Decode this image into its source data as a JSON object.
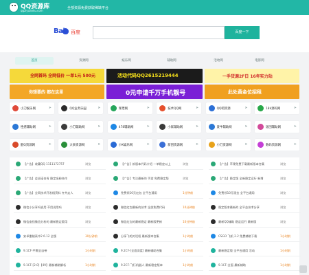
{
  "header": {
    "logo_title": "QQ资源库",
    "logo_sub": "qqziyuanku.com",
    "slogan": "全部资源免费获取稀缺平台"
  },
  "search": {
    "brand": "Bai",
    "brand_cn": "百度",
    "placeholder": "",
    "button": "百度一下"
  },
  "tabs": [
    "首页",
    "资源网",
    "娱乐网",
    "辅助网",
    "活动网",
    "电影网"
  ],
  "ads": [
    {
      "text": "全网首码 全网低价 一单1元 500元",
      "bg": "#f5d93a",
      "color": "#c01515"
    },
    {
      "text": "活动代码QQ2615219444",
      "bg": "#1b1b1b",
      "color": "#f8e21b"
    },
    {
      "text": "一手货源2F日 16年实力站",
      "bg": "#fff3a8",
      "color": "#d02a2a"
    },
    {
      "text": "你想要的 都在这里",
      "bg": "#f3a726",
      "color": "#ffffff"
    },
    {
      "text": "0元申请千万手机靓号",
      "bg": "#7a1fd6",
      "color": "#ffffff"
    },
    {
      "text": "此处黄金位招租",
      "bg": "#f0a020",
      "color": "#ffffff"
    }
  ],
  "cards": [
    {
      "label": "小刀娱乐网",
      "color": "#e04a3a"
    },
    {
      "label": "QQ业务乐园",
      "color": "#2a2a2a"
    },
    {
      "label": "辉煌网",
      "color": "#26a65b"
    },
    {
      "label": "技术QQ网",
      "color": "#e6502d"
    },
    {
      "label": "QQ吧资源",
      "color": "#2b6fd6"
    },
    {
      "label": "18k源码网",
      "color": "#28a84a"
    },
    {
      "label": "性感辅助网",
      "color": "#2b78d6"
    },
    {
      "label": "小刀辅助网",
      "color": "#3b3b3b"
    },
    {
      "label": "478辅助网",
      "color": "#1e88e5"
    },
    {
      "label": "小家辅助网",
      "color": "#3a3a3a"
    },
    {
      "label": "爱牛辅助网",
      "color": "#2b78d6"
    },
    {
      "label": "饭团辅助网",
      "color": "#d24a9a"
    },
    {
      "label": "酷Q资源网",
      "color": "#d94b2b"
    },
    {
      "label": "大表资源网",
      "color": "#2a8f3a"
    },
    {
      "label": "小K娱乐网",
      "color": "#2a6bd6"
    },
    {
      "label": "新团资源网",
      "color": "#3b6fd6"
    },
    {
      "label": "小刀资源网",
      "color": "#e8a21a"
    },
    {
      "label": "数码资源网",
      "color": "#c43fd6"
    }
  ],
  "list": [
    [
      {
        "label": "【广告】收藏QQ 1111172757",
        "tag": "浏览",
        "hot": false,
        "color": "#2aa876"
      },
      {
        "label": "【广告】会说诺合肯 稳定吸粉合作",
        "tag": "浏览",
        "hot": false,
        "color": "#2aa876"
      },
      {
        "label": "【广告】全网技术开发相资料 齐共走人",
        "tag": "浏览",
        "hot": false,
        "color": "#2aa876"
      },
      {
        "label": "微信小分享吗说用 不用说用吗",
        "tag": "浏览",
        "hot": false,
        "color": "#2c2c2c"
      },
      {
        "label": "微信查找微信分析的 最新稳定版用",
        "tag": "浏览",
        "hot": false,
        "color": "#2c2c2c"
      },
      {
        "label": "安卓重制表中2 6.12 全版",
        "tag": "30分钟前",
        "hot": true,
        "color": "#1e88e5"
      },
      {
        "label": "9.1CF-不需全自带",
        "tag": "1小时前",
        "hot": true,
        "color": "#1fb39d"
      },
      {
        "label": "9.1CF-[2.0]【49】最新辅助解析",
        "tag": "1小时前",
        "hot": true,
        "color": "#1fb39d"
      }
    ],
    [
      {
        "label": "【广告】新版本代码介绍 一单稳定以上",
        "tag": "浏览",
        "hot": false,
        "color": "#2aa876"
      },
      {
        "label": "【广告】专注最新的 手游 免费稳定版",
        "tag": "浏览",
        "hot": false,
        "color": "#2aa876"
      },
      {
        "label": "免费领10元红包 全平台通用",
        "tag": "1分钟前",
        "hot": true,
        "color": "#1e88e5"
      },
      {
        "label": "微信红包最新的技术 全部免费代码",
        "tag": "10分钟前",
        "hot": true,
        "color": "#2c2c2c"
      },
      {
        "label": "微信红包的最新稳定 最新版更新",
        "tag": "10分钟前",
        "hot": true,
        "color": "#2c2c2c"
      },
      {
        "label": "分享飞吧对话框 最新版本合集",
        "tag": "1小时前",
        "hot": true,
        "color": "#2c2c2c"
      },
      {
        "label": "9.2CF-[全面深度] 最新辅助合集",
        "tag": "1小时前",
        "hot": true,
        "color": "#1fb39d"
      },
      {
        "label": "9.2CF-飞行机器人 最新稳定版本",
        "tag": "1小时前",
        "hot": true,
        "color": "#1fb39d"
      }
    ],
    [
      {
        "label": "【广告】苹果免费下载最新版本合集",
        "tag": "浏览",
        "hot": false,
        "color": "#2aa876"
      },
      {
        "label": "【广告】稳定版 全新稳定运行 新增",
        "tag": "浏览",
        "hot": false,
        "color": "#2aa876"
      },
      {
        "label": "免费领10元现金 全平台通用",
        "tag": "浏览",
        "hot": false,
        "color": "#1e88e5"
      },
      {
        "label": "稳定版本最新的 全平台技术分享",
        "tag": "浏览",
        "hot": false,
        "color": "#2c2c2c"
      },
      {
        "label": "最新QQ辅助 稳定运行 最新版",
        "tag": "浏览",
        "hot": false,
        "color": "#2c2c2c"
      },
      {
        "label": "CSGO 飞机 2.2 免费辅助下载",
        "tag": "1小时前",
        "hot": true,
        "color": "#1e88e5"
      },
      {
        "label": "最新稳定版 全平台通用 活动",
        "tag": "1小时前",
        "hot": true,
        "color": "#1fb39d"
      },
      {
        "label": "9.1CF-全面 最新辅助",
        "tag": "1小时前",
        "hot": true,
        "color": "#1fb39d"
      }
    ]
  ]
}
